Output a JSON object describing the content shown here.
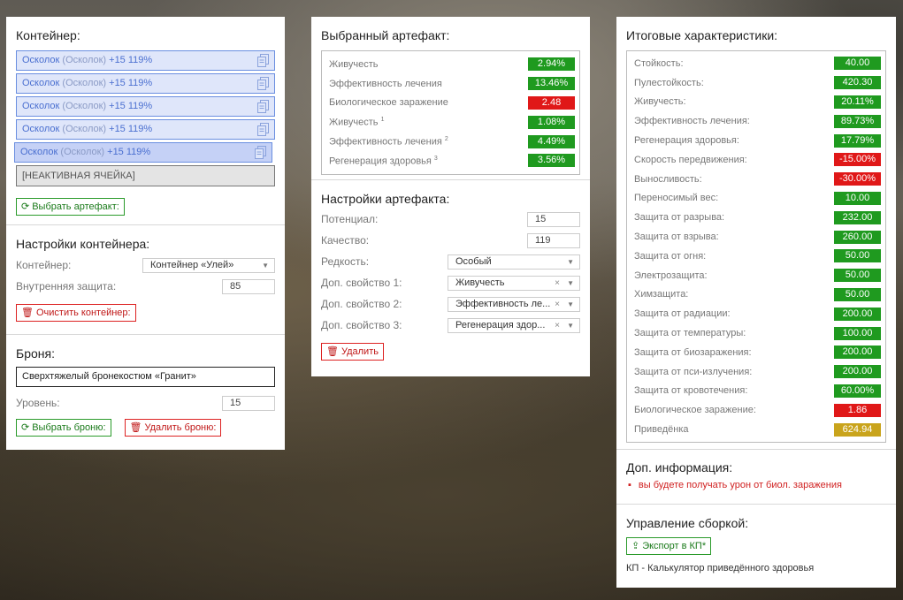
{
  "container_panel": {
    "title": "Контейнер:",
    "slots": [
      {
        "name": "Осколок",
        "alt": "(Осколок)",
        "stats": "+15 119%"
      },
      {
        "name": "Осколок",
        "alt": "(Осколок)",
        "stats": "+15 119%"
      },
      {
        "name": "Осколок",
        "alt": "(Осколок)",
        "stats": "+15 119%"
      },
      {
        "name": "Осколок",
        "alt": "(Осколок)",
        "stats": "+15 119%"
      },
      {
        "name": "Осколок",
        "alt": "(Осколок)",
        "stats": "+15 119%"
      }
    ],
    "inactive_slot": "[НЕАКТИВНАЯ ЯЧЕЙКА]",
    "choose_artifact_button": "Выбрать артефакт:",
    "settings": {
      "title": "Настройки контейнера:",
      "container_label": "Контейнер:",
      "container_value": "Контейнер «Улей»",
      "protection_label": "Внутренняя защита:",
      "protection_value": "85",
      "clear_button": "Очистить контейнер:"
    },
    "armor": {
      "title": "Броня:",
      "name": "Сверхтяжелый бронекостюм «Гранит»",
      "level_label": "Уровень:",
      "level_value": "15",
      "choose_button": "Выбрать броню:",
      "remove_button": "Удалить броню:"
    }
  },
  "artifact_panel": {
    "title": "Выбранный артефакт:",
    "stats": [
      {
        "label": "Живучесть",
        "sup": "",
        "value": "2.94%",
        "color": "green"
      },
      {
        "label": "Эффективность лечения",
        "sup": "",
        "value": "13.46%",
        "color": "green"
      },
      {
        "label": "Биологическое заражение",
        "sup": "",
        "value": "2.48",
        "color": "red"
      },
      {
        "label": "Живучесть",
        "sup": "1",
        "value": "1.08%",
        "color": "green"
      },
      {
        "label": "Эффективность лечения",
        "sup": "2",
        "value": "4.49%",
        "color": "green"
      },
      {
        "label": "Регенерация здоровья",
        "sup": "3",
        "value": "3.56%",
        "color": "green"
      }
    ],
    "settings": {
      "title": "Настройки артефакта:",
      "potential_label": "Потенциал:",
      "potential_value": "15",
      "quality_label": "Качество:",
      "quality_value": "119",
      "rarity_label": "Редкость:",
      "rarity_value": "Особый",
      "extra1_label": "Доп. свойство 1:",
      "extra1_value": "Живучесть",
      "extra2_label": "Доп. свойство 2:",
      "extra2_value": "Эффективность ле...",
      "extra3_label": "Доп. свойство 3:",
      "extra3_value": "Регенерация здор...",
      "delete_button": "Удалить"
    }
  },
  "totals_panel": {
    "title": "Итоговые характеристики:",
    "stats": [
      {
        "label": "Стойкость:",
        "value": "40.00",
        "color": "green"
      },
      {
        "label": "Пулестойкость:",
        "value": "420.30",
        "color": "green"
      },
      {
        "label": "Живучесть:",
        "value": "20.11%",
        "color": "green"
      },
      {
        "label": "Эффективность лечения:",
        "value": "89.73%",
        "color": "green"
      },
      {
        "label": "Регенерация здоровья:",
        "value": "17.79%",
        "color": "green"
      },
      {
        "label": "Скорость передвижения:",
        "value": "-15.00%",
        "color": "red"
      },
      {
        "label": "Выносливость:",
        "value": "-30.00%",
        "color": "red"
      },
      {
        "label": "Переносимый вес:",
        "value": "10.00",
        "color": "green"
      },
      {
        "label": "Защита от разрыва:",
        "value": "232.00",
        "color": "green"
      },
      {
        "label": "Защита от взрыва:",
        "value": "260.00",
        "color": "green"
      },
      {
        "label": "Защита от огня:",
        "value": "50.00",
        "color": "green"
      },
      {
        "label": "Электрозащита:",
        "value": "50.00",
        "color": "green"
      },
      {
        "label": "Химзащита:",
        "value": "50.00",
        "color": "green"
      },
      {
        "label": "Защита от радиации:",
        "value": "200.00",
        "color": "green"
      },
      {
        "label": "Защита от температуры:",
        "value": "100.00",
        "color": "green"
      },
      {
        "label": "Защита от биозаражения:",
        "value": "200.00",
        "color": "green"
      },
      {
        "label": "Защита от пси-излучения:",
        "value": "200.00",
        "color": "green"
      },
      {
        "label": "Защита от кровотечения:",
        "value": "60.00%",
        "color": "green"
      },
      {
        "label": "Биологическое заражение:",
        "value": "1.86",
        "color": "red"
      },
      {
        "label": "Приведёнка",
        "value": "624.94",
        "color": "gold"
      }
    ],
    "info_title": "Доп. информация:",
    "info_item": "вы будете получать урон от биол. заражения",
    "build_title": "Управление сборкой:",
    "export_button": "Экспорт в КП*",
    "footnote": "КП - Калькулятор приведённого здоровья"
  },
  "colors": {
    "green": "#1f9a1f",
    "red": "#e01818",
    "gold": "#c9a41c",
    "slot_blue": "#6a8ee0"
  }
}
